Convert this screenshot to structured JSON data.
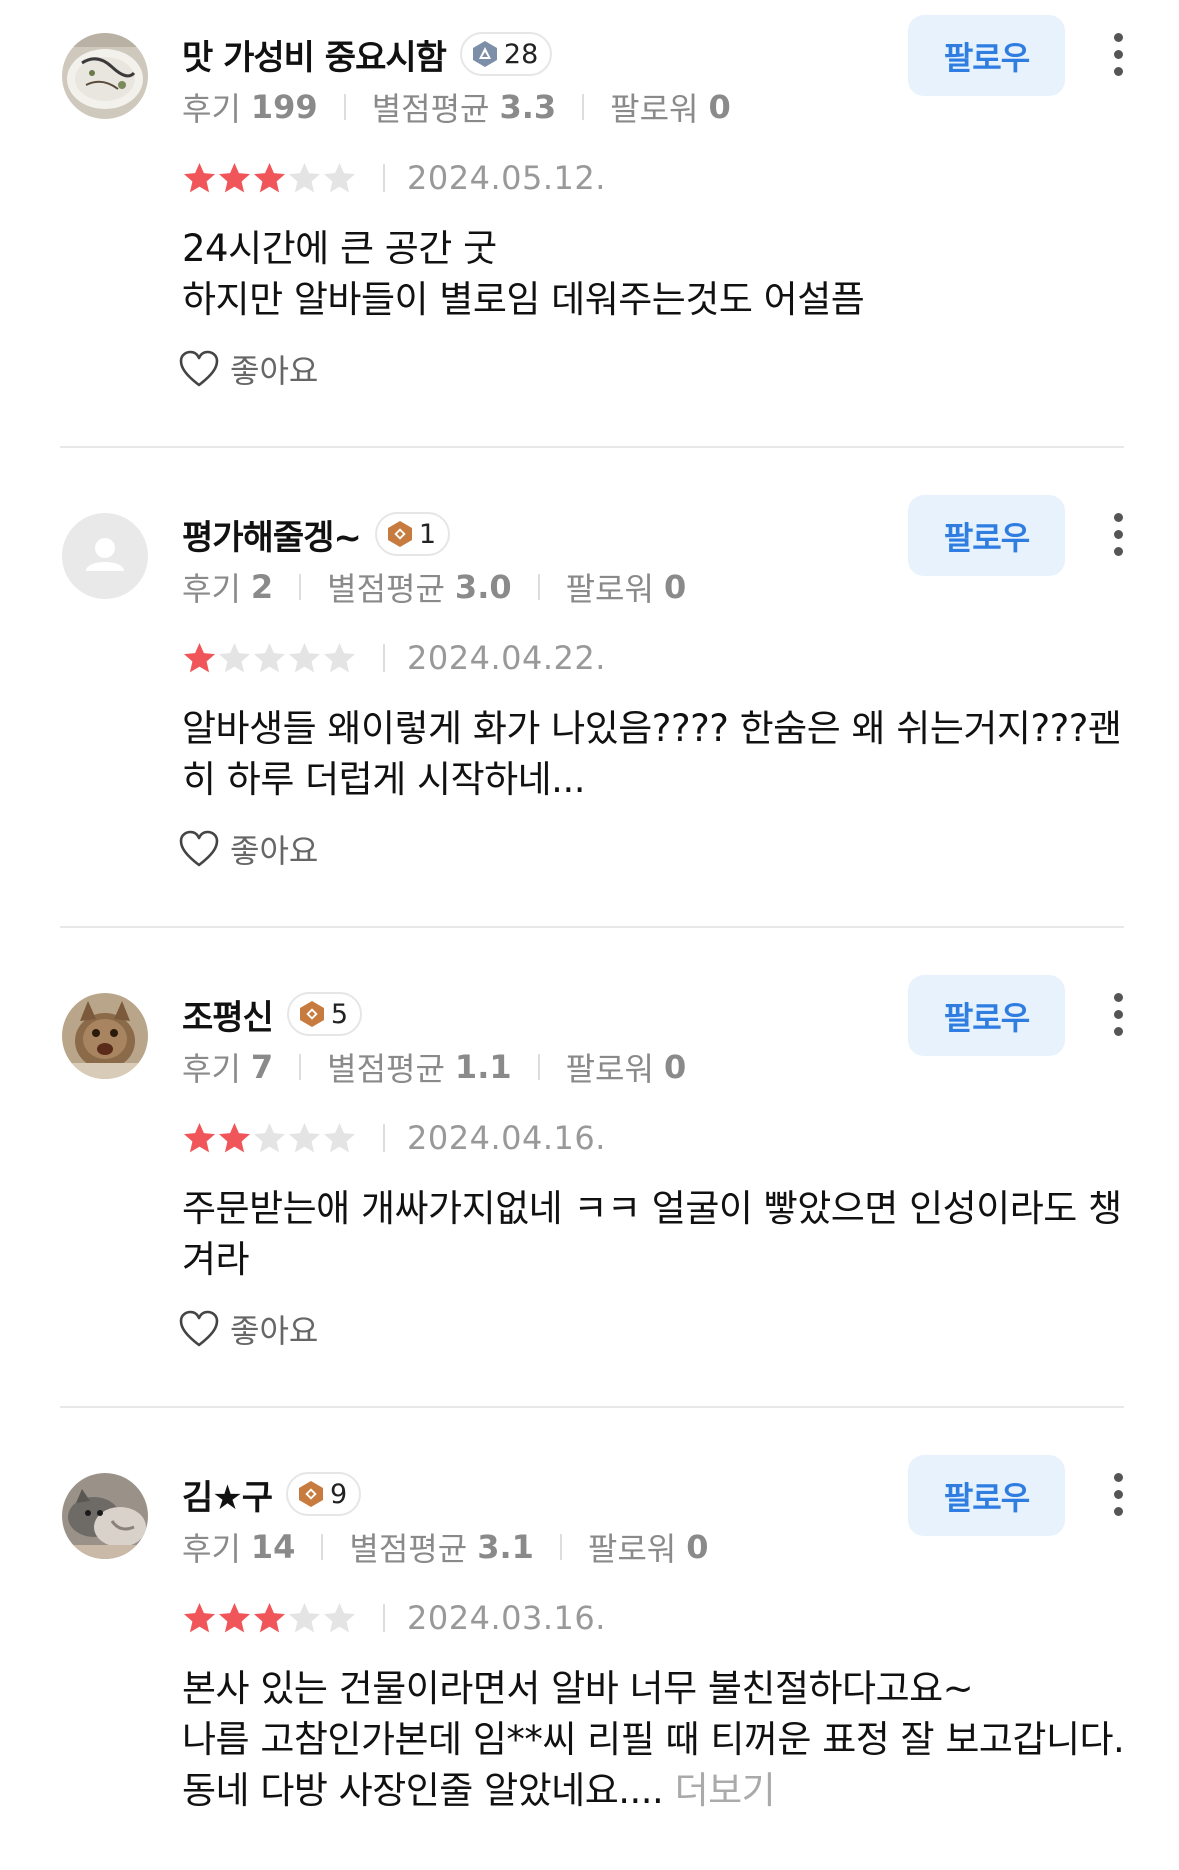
{
  "labels": {
    "follow": "팔로우",
    "like": "좋아요",
    "reviews": "후기",
    "avg_rating": "별점평균",
    "followers": "팔로워"
  },
  "colors": {
    "star_filled": "#f0555a",
    "star_empty": "#e4e4e4",
    "follow_bg": "#e7f2fd",
    "follow_text": "#2f7de1",
    "badge_bronze": "#c87b3e",
    "badge_silver": "#7d8ea8"
  },
  "reviews": [
    {
      "nickname": "맛 가성비 중요시함",
      "level": "28",
      "level_tier": "silver",
      "avatar": "food-photo-avatar",
      "review_count": "199",
      "avg_rating": "3.3",
      "followers": "0",
      "rating": 3,
      "date": "2024.05.12.",
      "text": "24시간에 큰 공간 굿\n하지만 알바들이 별로임 데워주는것도 어설픔"
    },
    {
      "nickname": "평가해줄겡~",
      "level": "1",
      "level_tier": "bronze",
      "avatar": "default-user-avatar",
      "review_count": "2",
      "avg_rating": "3.0",
      "followers": "0",
      "rating": 1,
      "date": "2024.04.22.",
      "text": "알바생들 왜이렇게 화가 나있음???? 한숨은 왜 쉬는거지???괜히 하루 더럽게 시작하네..."
    },
    {
      "nickname": "조평신",
      "level": "5",
      "level_tier": "bronze",
      "avatar": "cat-photo-avatar",
      "review_count": "7",
      "avg_rating": "1.1",
      "followers": "0",
      "rating": 2,
      "date": "2024.04.16.",
      "text": "주문받는애 개싸가지없네 ㅋㅋ 얼굴이 빻았으면 인성이라도 챙겨라"
    },
    {
      "nickname": "김★구",
      "level": "9",
      "level_tier": "bronze",
      "avatar": "cats-photo-avatar",
      "review_count": "14",
      "avg_rating": "3.1",
      "followers": "0",
      "rating": 3,
      "date": "2024.03.16.",
      "text": "본사 있는 건물이라면서 알바 너무 불친절하다고요~\n나름 고참인가본데 임**씨 리필 때 티꺼운 표정 잘 보고갑니다.\n동네 다방 사장인줄 알았네요....",
      "more_label": "더보기"
    }
  ]
}
